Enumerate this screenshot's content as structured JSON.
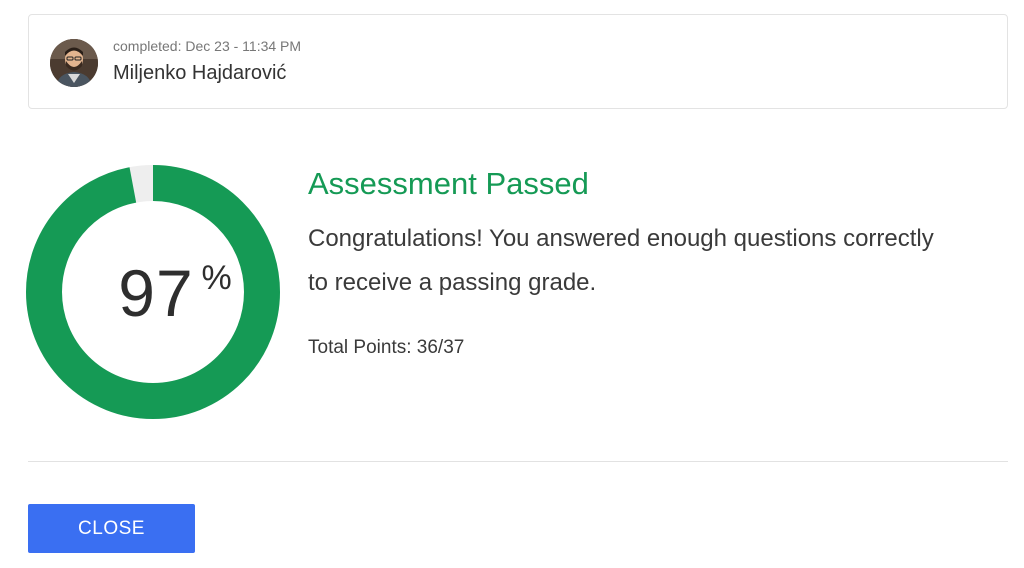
{
  "user": {
    "completed_text": "completed: Dec 23 - 11:34 PM",
    "name": "Miljenko Hajdarović"
  },
  "result": {
    "percent": "97",
    "percent_sign": "%",
    "score_fraction": 0.97,
    "title": "Assessment Passed",
    "message": "Congratulations! You answered enough questions correctly to receive a passing grade.",
    "points": "Total Points: 36/37"
  },
  "actions": {
    "close_label": "CLOSE"
  },
  "colors": {
    "pass_green": "#159a55",
    "ring_track": "#eeeeee",
    "button_blue": "#3a6ff2"
  },
  "icons": {
    "avatar": "user-avatar-photo"
  }
}
